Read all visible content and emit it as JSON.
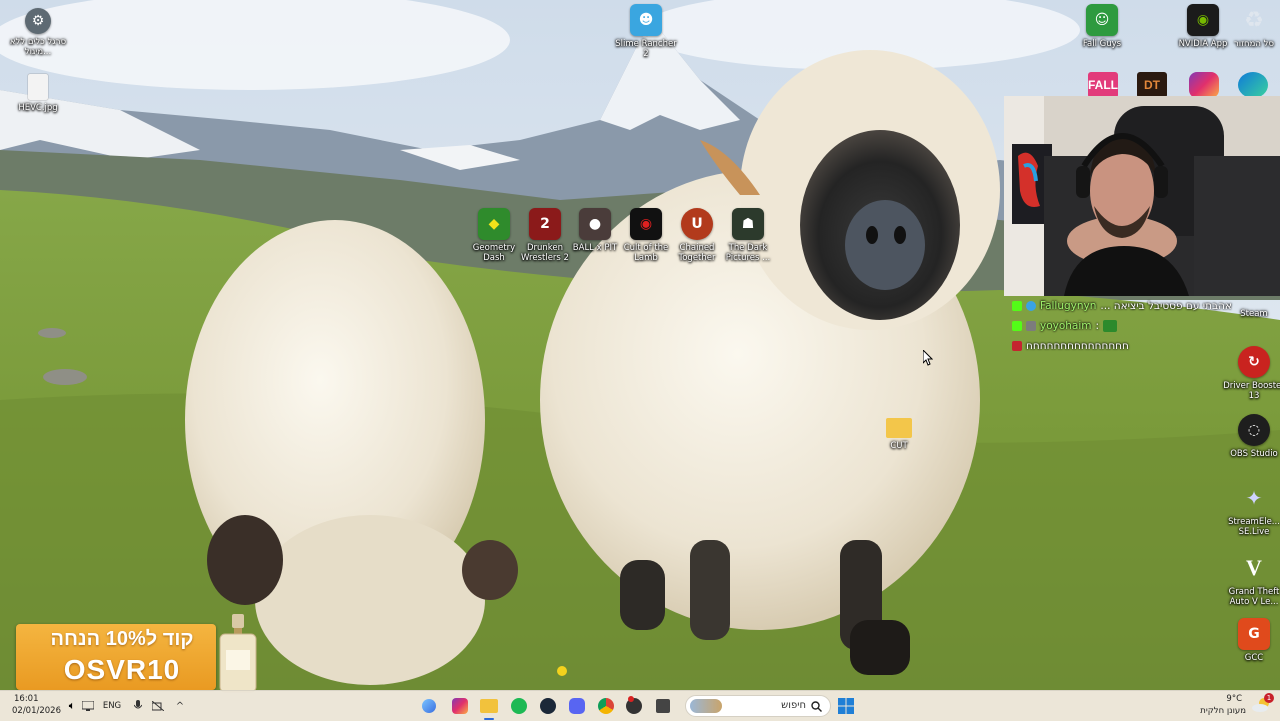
{
  "desktop_icons": {
    "top_left_1": "סרגל כלים ללא מיגול...",
    "top_left_2": "HEVC.jpg",
    "slime": "Slime Rancher 2",
    "geometry": "Geometry Dash",
    "drunken": "Drunken Wrestlers 2",
    "ball": "BALL x PIT",
    "cult": "Cult of the Lamb",
    "chained": "Chained Together",
    "dark": "The Dark Pictures ...",
    "cut": "CUT",
    "top_right_1": "Fall Guys",
    "nvidia": "NVIDIA App",
    "recycle": "סל המחזור",
    "steam": "Steam",
    "driver": "Driver Booster 13",
    "obs": "OBS Studio",
    "streamelements": "StreamEle... SE.Live",
    "gta": "Grand Theft Auto V Le...",
    "gcc": "GCC"
  },
  "top_right_row": {
    "fall_label": "FALL",
    "dt_label": "DT"
  },
  "chat": {
    "line1_user": "Fallugynyn",
    "line1_text": "אהבתי עם פסטיבל ביציאה ...",
    "line2_user": "yoyohaim",
    "line2_sep": " : ",
    "line3_text": "חחחחחחחחחחחחחחח"
  },
  "promo": {
    "line1": "קוד ל10% הנחה",
    "line2": "OSVR10"
  },
  "taskbar": {
    "time": "16:01",
    "date": "02/01/2026",
    "language": "ENG",
    "search_placeholder": "חיפוש",
    "temperature": "9°C",
    "weather": "מעונן חלקית",
    "notification_count": "1"
  },
  "colors": {
    "taskbar_bg": "#ebe5d6",
    "promo_orange": "#f0a830",
    "chat_user": "#9ff26b"
  }
}
